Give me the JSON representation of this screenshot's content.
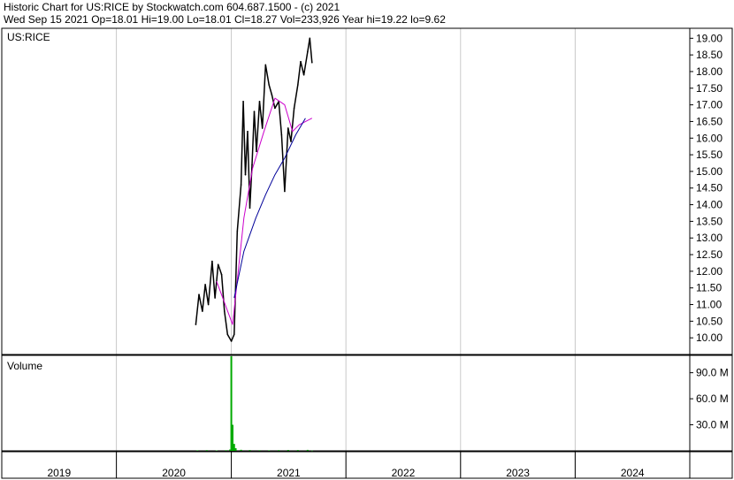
{
  "header": {
    "line1": "Historic Chart for US:RICE by Stockwatch.com 604.687.1500 - (c) 2021",
    "line2": "Wed Sep 15 2021   Op=18.01   Hi=19.00   Lo=18.01   Cl=18.27   Vol=233,926   Year hi=19.22   lo=9.62"
  },
  "colors": {
    "price": "#000000",
    "ma_short": "#cc00cc",
    "ma_long": "#000099",
    "volume": "#00aa00",
    "grid": "#c8c8c8"
  },
  "chart_data": [
    {
      "type": "line",
      "title": "US:RICE",
      "y_axis_side": "right",
      "ylim": [
        9.5,
        19.3
      ],
      "ytick_labels": [
        "19.00",
        "18.50",
        "18.00",
        "17.50",
        "17.00",
        "16.50",
        "16.00",
        "15.50",
        "15.00",
        "14.50",
        "14.00",
        "13.50",
        "13.00",
        "12.50",
        "12.00",
        "11.50",
        "11.00",
        "10.50",
        "10.00"
      ],
      "x_axis": {
        "start": "2019-01-01",
        "end": "2024-12-31",
        "year_labels": [
          "2019",
          "2020",
          "2021",
          "2022",
          "2023",
          "2024"
        ]
      },
      "series": [
        {
          "name": "",
          "kind": "price",
          "x": [
            "2020-09-10",
            "2020-09-20",
            "2020-10-01",
            "2020-10-10",
            "2020-10-20",
            "2020-11-01",
            "2020-11-10",
            "2020-11-20",
            "2020-12-01",
            "2020-12-10",
            "2020-12-20",
            "2021-01-01",
            "2021-01-10",
            "2021-01-20",
            "2021-02-01",
            "2021-02-08",
            "2021-02-15",
            "2021-02-22",
            "2021-03-01",
            "2021-03-08",
            "2021-03-15",
            "2021-03-22",
            "2021-04-01",
            "2021-04-10",
            "2021-04-20",
            "2021-05-01",
            "2021-05-10",
            "2021-05-20",
            "2021-06-01",
            "2021-06-10",
            "2021-06-20",
            "2021-07-01",
            "2021-07-10",
            "2021-07-20",
            "2021-08-01",
            "2021-08-10",
            "2021-08-20",
            "2021-09-01",
            "2021-09-08",
            "2021-09-15"
          ],
          "values": [
            10.4,
            11.3,
            10.8,
            11.6,
            11.0,
            12.3,
            11.2,
            12.2,
            11.9,
            10.8,
            10.1,
            9.9,
            10.1,
            13.2,
            14.6,
            17.1,
            14.9,
            16.2,
            13.9,
            15.2,
            16.8,
            15.6,
            17.1,
            16.3,
            18.2,
            17.6,
            17.3,
            16.9,
            17.1,
            16.1,
            14.4,
            16.3,
            15.9,
            16.9,
            17.6,
            18.3,
            17.9,
            18.6,
            19.0,
            18.27
          ]
        },
        {
          "name": "",
          "kind": "moving_average_short",
          "x": [
            "2020-11-15",
            "2021-01-05",
            "2021-02-10",
            "2021-03-10",
            "2021-04-15",
            "2021-05-20",
            "2021-06-20",
            "2021-07-15",
            "2021-08-05",
            "2021-09-15"
          ],
          "values": [
            11.7,
            10.4,
            13.6,
            15.1,
            16.2,
            17.2,
            17.0,
            16.2,
            16.4,
            16.6
          ]
        },
        {
          "name": "",
          "kind": "moving_average_long",
          "x": [
            "2021-01-10",
            "2021-02-10",
            "2021-03-20",
            "2021-04-20",
            "2021-05-20",
            "2021-06-20",
            "2021-07-25",
            "2021-08-25"
          ],
          "values": [
            11.2,
            12.6,
            13.6,
            14.3,
            14.9,
            15.4,
            16.1,
            16.6
          ]
        }
      ]
    },
    {
      "type": "bar",
      "title": "Volume",
      "y_axis_side": "right",
      "ylim": [
        0,
        110
      ],
      "ytick_labels": [
        "90.0 M",
        "60.0 M",
        "30.0 M"
      ],
      "ytick_values": [
        90,
        60,
        30
      ],
      "unit": "M",
      "x": [
        "2020-09-15",
        "2020-10-15",
        "2020-11-15",
        "2020-12-15",
        "2020-12-28",
        "2021-01-01",
        "2021-01-05",
        "2021-01-10",
        "2021-01-15",
        "2021-02-01",
        "2021-03-01",
        "2021-04-01",
        "2021-05-01",
        "2021-06-01",
        "2021-07-01",
        "2021-08-01",
        "2021-09-01",
        "2021-09-15"
      ],
      "values": [
        0.6,
        0.8,
        0.5,
        0.7,
        1.5,
        125,
        30,
        8,
        3,
        1.2,
        0.9,
        0.7,
        0.6,
        0.8,
        1.0,
        0.9,
        1.1,
        0.23
      ]
    }
  ]
}
